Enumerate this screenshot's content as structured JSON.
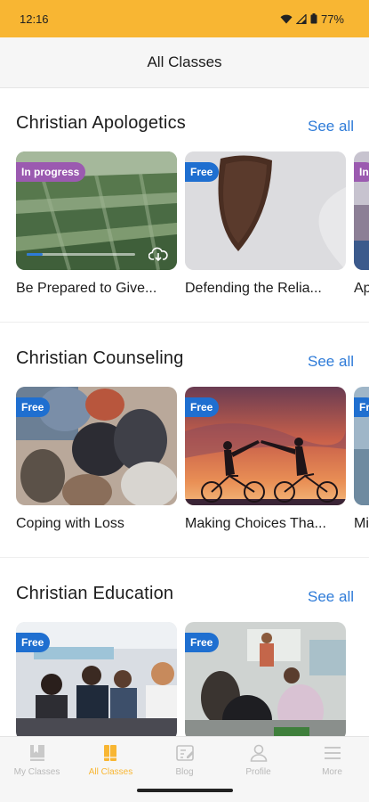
{
  "status_bar": {
    "time": "12:16",
    "battery": "77%"
  },
  "header": {
    "title": "All Classes"
  },
  "see_all_label": "See all",
  "sections": [
    {
      "title": "Christian Apologetics",
      "cards": [
        {
          "title": "Be Prepared to Give...",
          "badge": "In progress",
          "progress": 0.15,
          "download_icon": "cloud-download-icon"
        },
        {
          "title": "Defending the Relia...",
          "badge": "Free"
        },
        {
          "title": "Ap",
          "badge": "In"
        }
      ]
    },
    {
      "title": "Christian Counseling",
      "cards": [
        {
          "title": "Coping with Loss",
          "badge": "Free"
        },
        {
          "title": "Making Choices Tha...",
          "badge": "Free"
        },
        {
          "title": "Mi",
          "badge": "Fr"
        }
      ]
    },
    {
      "title": "Christian Education",
      "cards": [
        {
          "title": "",
          "badge": "Free"
        },
        {
          "title": "",
          "badge": "Free"
        }
      ]
    }
  ],
  "bottom_nav": [
    {
      "label": "My Classes",
      "icon": "my-classes-icon",
      "active": false
    },
    {
      "label": "All Classes",
      "icon": "all-classes-icon",
      "active": true
    },
    {
      "label": "Blog",
      "icon": "blog-icon",
      "active": false
    },
    {
      "label": "Profile",
      "icon": "profile-icon",
      "active": false
    },
    {
      "label": "More",
      "icon": "more-icon",
      "active": false
    }
  ],
  "colors": {
    "accent": "#f8b633",
    "link": "#2e7bd8",
    "free_badge": "#1f6fd0",
    "progress_badge": "#9b5ab0"
  }
}
